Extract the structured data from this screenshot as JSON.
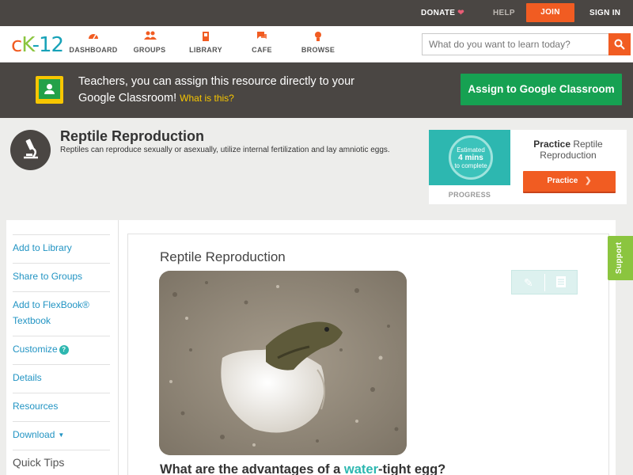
{
  "topbar": {
    "donate": "DONATE",
    "help": "HELP",
    "join": "JOIN",
    "sign_in": "SIGN IN"
  },
  "brand": {
    "c": "c",
    "k": "K",
    "num": "-12"
  },
  "nav": {
    "items": [
      {
        "label": "DASHBOARD",
        "icon": "dashboard-icon"
      },
      {
        "label": "GROUPS",
        "icon": "groups-icon"
      },
      {
        "label": "LIBRARY",
        "icon": "library-icon"
      },
      {
        "label": "CAFE",
        "icon": "cafe-icon"
      },
      {
        "label": "BROWSE",
        "icon": "browse-icon"
      }
    ],
    "search_placeholder": "What do you want to learn today?"
  },
  "banner": {
    "text": "Teachers, you can assign this resource directly to your Google Classroom!",
    "what_is_this": "What is this?",
    "assign_button": "Assign to Google Classroom"
  },
  "resource": {
    "title": "Reptile Reproduction",
    "description": "Reptiles can reproduce sexually or asexually, utilize internal fertilization and lay amniotic eggs."
  },
  "practice": {
    "estimate_line1": "Estimated",
    "estimate_mins": "4 mins",
    "estimate_line3": "to complete",
    "progress_label": "PROGRESS",
    "title_bold": "Practice",
    "title_rest": " Reptile Reproduction",
    "button": "Practice"
  },
  "sidebar": {
    "items": [
      {
        "label": "Add to Library"
      },
      {
        "label": "Share to Groups"
      },
      {
        "label": "Add to FlexBook® Textbook"
      },
      {
        "label": "Customize"
      },
      {
        "label": "Details"
      },
      {
        "label": "Resources"
      },
      {
        "label": "Download"
      }
    ],
    "quick_tips": "Quick Tips"
  },
  "article": {
    "title": "Reptile Reproduction",
    "question_before": "What are the advantages of a ",
    "question_keyword": "water",
    "question_after": "-tight egg?"
  },
  "support": "Support",
  "colors": {
    "accent": "#f15c22",
    "dark": "#4a4643",
    "green": "#16a152",
    "teal": "#2db7b0",
    "link": "#2294c3"
  }
}
